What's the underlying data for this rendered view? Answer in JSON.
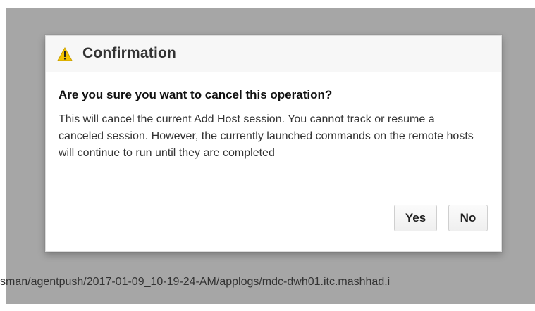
{
  "dialog": {
    "title": "Confirmation",
    "icon": "warning-icon",
    "question": "Are you sure you want to cancel this operation?",
    "message": "This will cancel the current Add Host session. You cannot track or resume a canceled session. However, the currently launched commands on the remote hosts will continue to run until they are completed",
    "buttons": {
      "yes": "Yes",
      "no": "No"
    }
  },
  "background": {
    "path_text": "sman/agentpush/2017-01-09_10-19-24-AM/applogs/mdc-dwh01.itc.mashhad.i"
  },
  "colors": {
    "overlay": "#a6a6a6",
    "warning": "#f2c200"
  }
}
